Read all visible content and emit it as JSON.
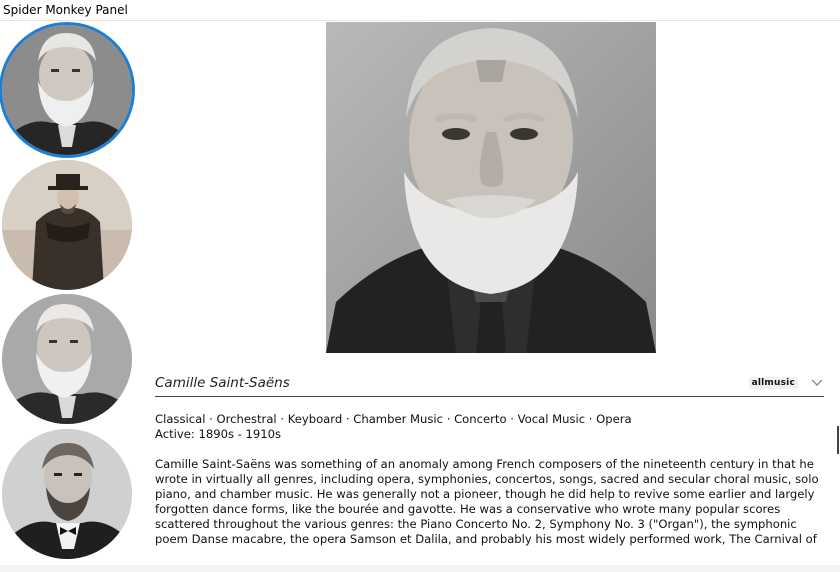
{
  "window": {
    "title": "Spider Monkey Panel"
  },
  "thumbnails": [
    {
      "name": "thumbnail-portrait-1",
      "selected": true
    },
    {
      "name": "thumbnail-portrait-2",
      "selected": false
    },
    {
      "name": "thumbnail-portrait-3",
      "selected": false
    },
    {
      "name": "thumbnail-portrait-4",
      "selected": false
    }
  ],
  "artist": {
    "name": "Camille Saint-Saëns",
    "source": "allmusic",
    "genres": "Classical · Orchestral · Keyboard · Chamber Music · Concerto · Vocal Music · Opera",
    "active": "Active: 1890s - 1910s",
    "bio": "Camille Saint-Saëns was something of an anomaly among French composers of the nineteenth century in that he wrote in virtually all genres, including opera, symphonies, concertos, songs, sacred and secular choral music, solo piano, and chamber music. He was generally not a pioneer, though he did help to revive some earlier and largely forgotten dance forms, like the bourée and gavotte. He was a conservative who wrote many popular scores scattered throughout the various genres: the Piano Concerto No. 2, Symphony No. 3 (\"Organ\"), the symphonic poem Danse macabre, the opera Samson et Dalila, and probably his most widely performed work, The Carnival of The Animals. While he remained a composer closely tied to tradition and"
  },
  "colors": {
    "selection_ring": "#1e7fd2",
    "divider": "#444444"
  }
}
